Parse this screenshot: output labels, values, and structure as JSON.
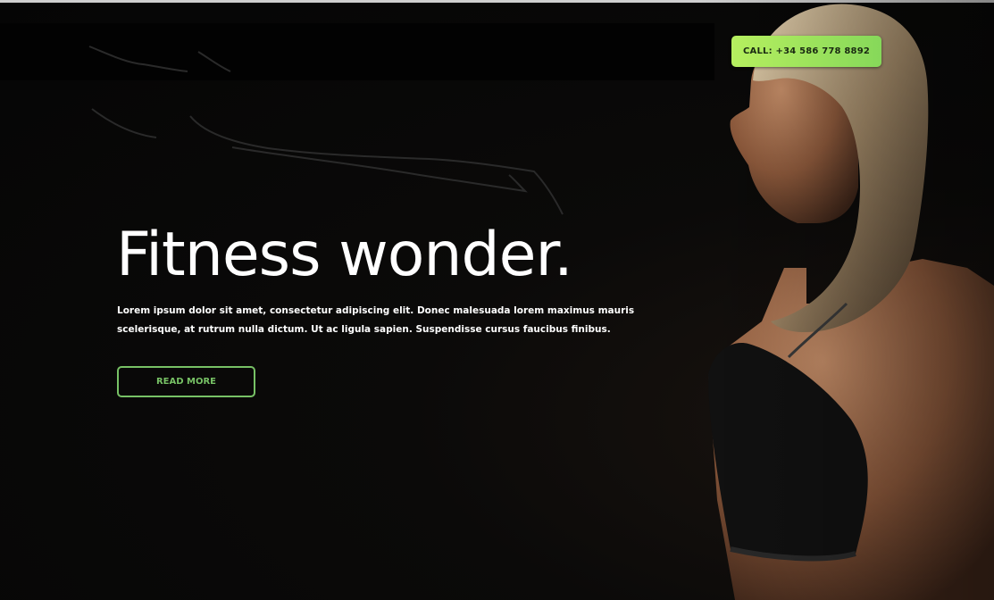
{
  "header": {
    "call_label": "CALL: +34 586 778 8892"
  },
  "hero": {
    "headline": "Fitness wonder.",
    "description": "Lorem ipsum dolor sit amet, consectetur adipiscing elit. Donec malesuada lorem maximus mauris scelerisque, at rutrum nulla dictum. Ut ac ligula sapien. Suspendisse cursus faucibus finibus.",
    "read_more_label": "READ MORE"
  },
  "colors": {
    "background": "#050505",
    "accent_green": "#77c165",
    "call_button_gradient_start": "#b6ef5f",
    "call_button_gradient_end": "#86d85a",
    "text": "#ffffff"
  },
  "icons": {
    "scribble": "hand-drawn-scribble-lines",
    "hero_image": "woman-athlete-profile-photo"
  }
}
